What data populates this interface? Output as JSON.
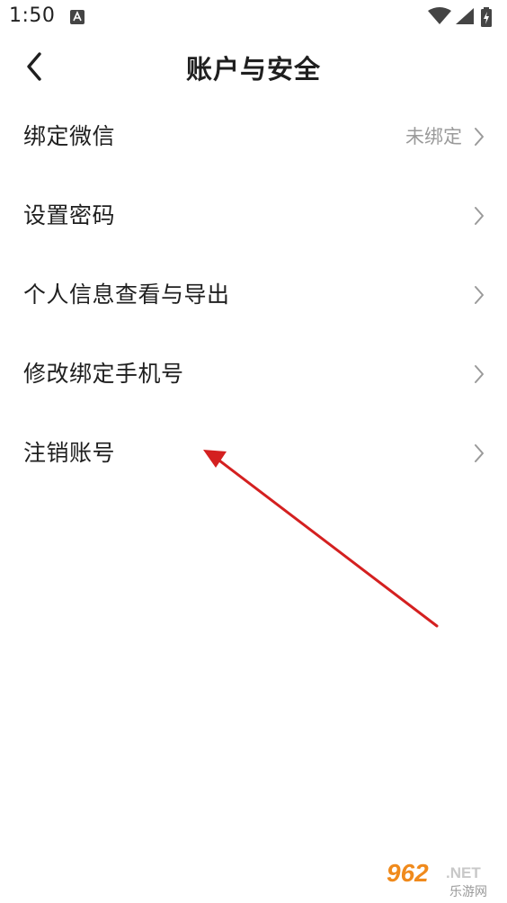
{
  "status_bar": {
    "time": "1:50",
    "notification_icon": "a-notification-icon",
    "wifi_icon": "wifi-icon",
    "signal_icon": "cell-signal-icon",
    "battery_icon": "battery-charging-icon"
  },
  "header": {
    "title": "账户与安全",
    "back_icon": "chevron-left-icon"
  },
  "items": [
    {
      "label": "绑定微信",
      "value": "未绑定"
    },
    {
      "label": "设置密码",
      "value": ""
    },
    {
      "label": "个人信息查看与导出",
      "value": ""
    },
    {
      "label": "修改绑定手机号",
      "value": ""
    },
    {
      "label": "注销账号",
      "value": ""
    }
  ],
  "watermark": {
    "brand": "962.NET",
    "sub": "乐游网"
  },
  "colors": {
    "annotation_arrow": "#d42020",
    "chevron": "#9a9a9a",
    "secondary_text": "#9a9a9a"
  }
}
